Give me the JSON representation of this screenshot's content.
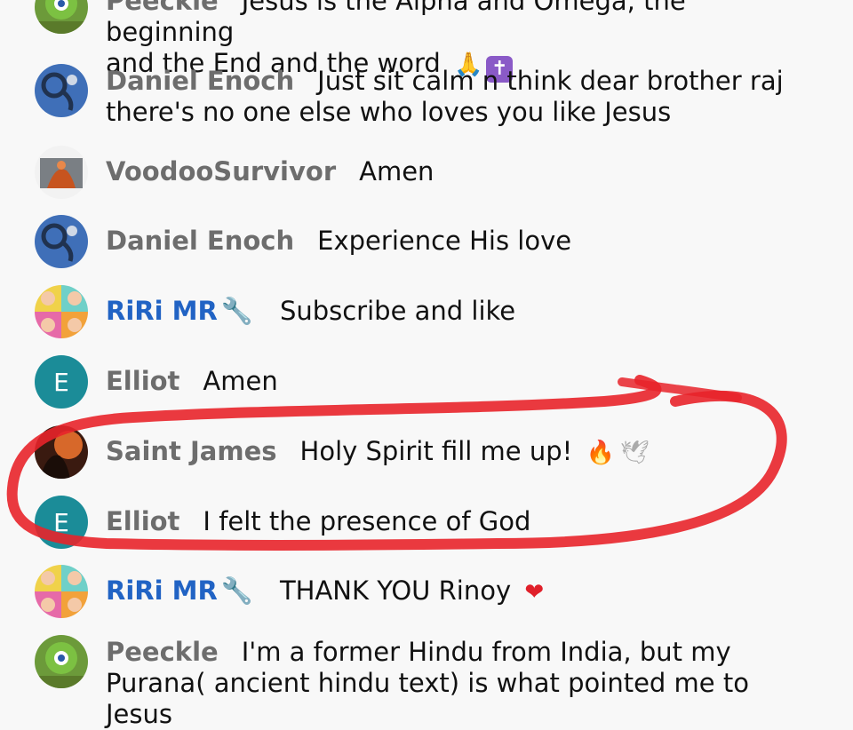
{
  "messages": [
    {
      "author": "Peeckle",
      "text_lines": [
        "Jesus is the Alpha and Omega, the beginning",
        "and the End and the word"
      ],
      "emoji": "🙏",
      "extra": "✝",
      "owner": false
    },
    {
      "author": "Daniel Enoch",
      "text": "Just sit calm n think dear brother raj",
      "text2": "there's no one else who loves you like Jesus",
      "owner": false
    },
    {
      "author": "VoodooSurvivor",
      "text": "Amen",
      "owner": false
    },
    {
      "author": "Daniel Enoch",
      "text": "Experience His love",
      "owner": false
    },
    {
      "author": "RiRi MR",
      "text": "Subscribe and like",
      "owner": true,
      "badge": "🔧"
    },
    {
      "author": "Elliot",
      "text": "Amen",
      "avatar_letter": "E",
      "owner": false
    },
    {
      "author": "Saint James",
      "text": "Holy Spirit fill me up!",
      "emoji": "🔥",
      "emoji2": "🕊",
      "owner": false
    },
    {
      "author": "Elliot",
      "text": "I felt the presence of God",
      "avatar_letter": "E",
      "owner": false
    },
    {
      "author": "RiRi MR",
      "text": "THANK YOU Rinoy",
      "emoji": "❤",
      "owner": true,
      "badge": "🔧"
    },
    {
      "author": "Peeckle",
      "text": "I'm a former Hindu from India, but my",
      "text2": "Purana( ancient hindu text) is what pointed me to Jesus",
      "owner": false
    }
  ],
  "colors": {
    "owner": "#2163c4",
    "author": "#6d6d6d",
    "annotation": "#e8232a",
    "letter_avatar": "#1b8c98"
  }
}
